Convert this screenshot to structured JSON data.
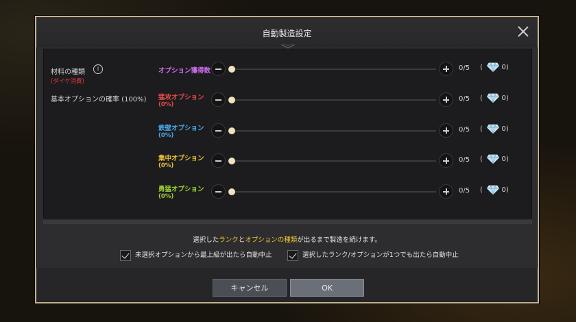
{
  "dialog": {
    "title": "自動製造設定",
    "left": {
      "material_label": "材料の種類",
      "material_sub": "(ダイヤ消費)",
      "probability_label": "基本オプションの確率 (100%)"
    },
    "options": [
      {
        "name": "オプション獲得数",
        "pct": "",
        "color": "#d06ef0",
        "count": "0/5",
        "level": 0,
        "gem_open": "(",
        "gem_value": "0",
        "gem_close": ")"
      },
      {
        "name": "猛攻オプション",
        "pct": "(0%)",
        "color": "#e84a4a",
        "count": "0/5",
        "level": 0,
        "gem_open": "(",
        "gem_value": "0",
        "gem_close": ")"
      },
      {
        "name": "鉄壁オプション",
        "pct": "(0%)",
        "color": "#4aa8e8",
        "count": "0/5",
        "level": 0,
        "gem_open": "(",
        "gem_value": "0",
        "gem_close": ")"
      },
      {
        "name": "集中オプション",
        "pct": "(0%)",
        "color": "#e8c23a",
        "count": "0/5",
        "level": 0,
        "gem_open": "(",
        "gem_value": "0",
        "gem_close": ")"
      },
      {
        "name": "勇猛オプション",
        "pct": "(0%)",
        "color": "#9ed030",
        "count": "0/5",
        "level": 0,
        "gem_open": "(",
        "gem_value": "0",
        "gem_close": ")"
      }
    ],
    "notice": {
      "part1": "選択した",
      "rank": "ランク",
      "part2": "と",
      "option_type": "オプションの種類",
      "part3": "が出るまで製造を続けます。"
    },
    "checkbox1": {
      "label": "未選択オプションから最上級が出たら自動中止",
      "checked": true
    },
    "checkbox2": {
      "label": "選択したランク/オプションが1つでも出たら自動中止",
      "checked": true
    },
    "buttons": {
      "cancel": "キャンセル",
      "ok": "OK"
    },
    "icons": {
      "close": "close-icon",
      "info": "info-icon",
      "gem": "diamond-icon"
    }
  }
}
